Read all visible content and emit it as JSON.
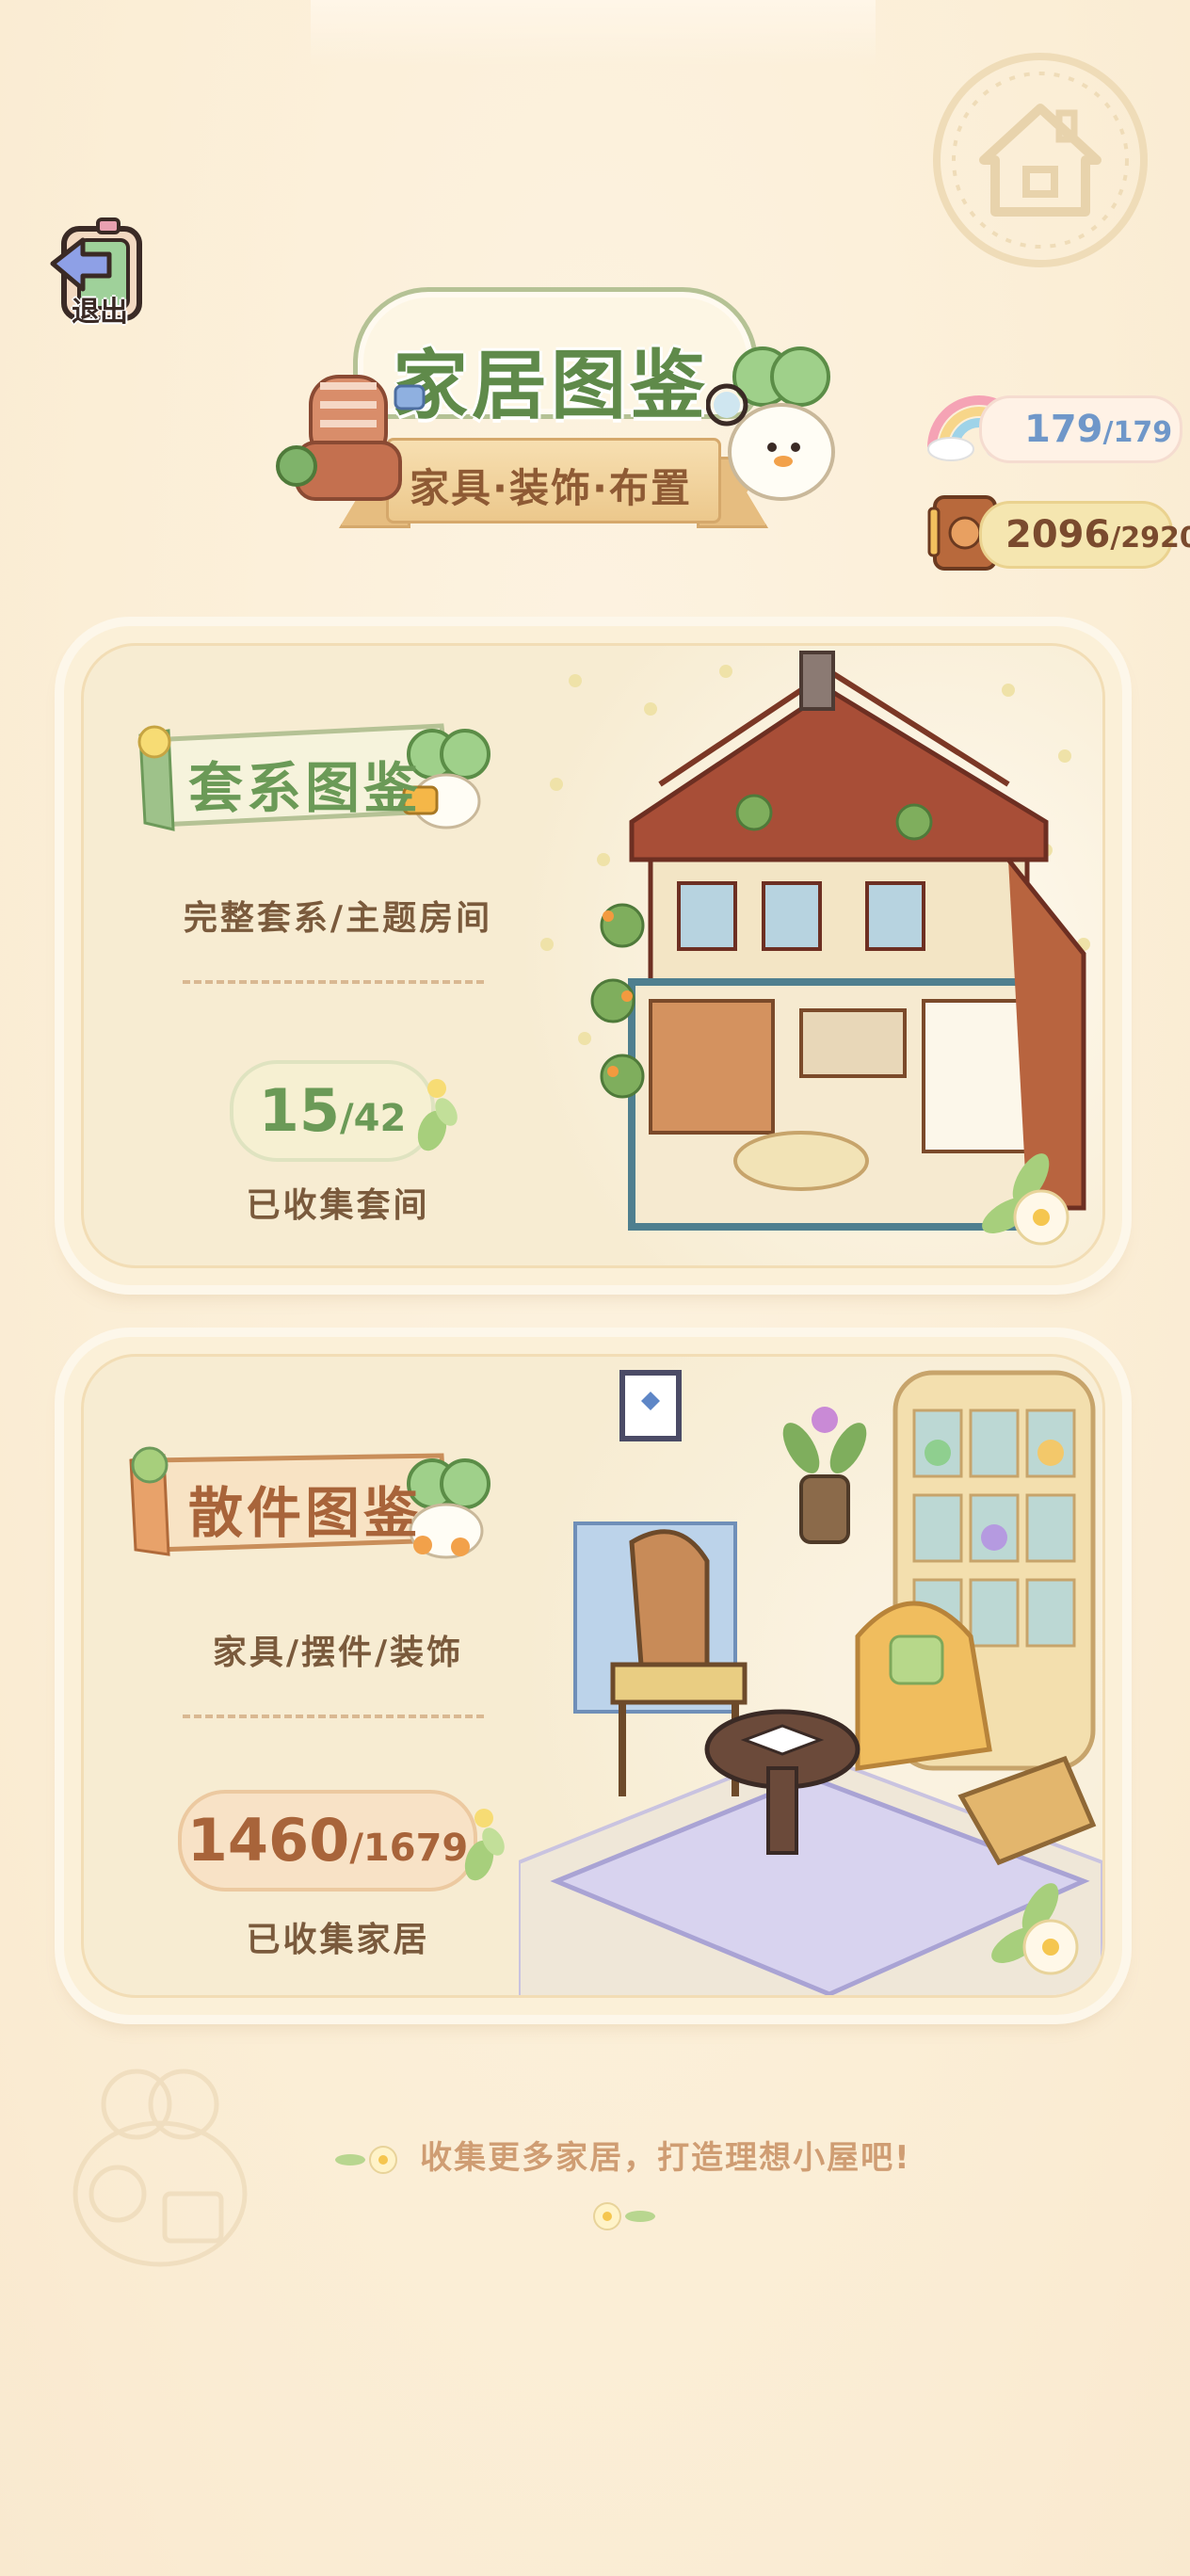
{
  "header": {
    "exit_label": "退出",
    "title": "家居图鉴",
    "subtitle": "家具·装饰·布置"
  },
  "currency": {
    "rainbow": {
      "current": "179",
      "max": "/179",
      "icon": "rainbow-icon"
    },
    "book": {
      "current": "2096",
      "max": "/2920",
      "icon": "book-icon"
    }
  },
  "cards": {
    "sets": {
      "tag": "套系图鉴",
      "description": "完整套系/主题房间",
      "count": "15",
      "total": "/42",
      "count_label": "已收集套间"
    },
    "items": {
      "tag": "散件图鉴",
      "description": "家具/摆件/装饰",
      "count": "1460",
      "total": "/1679",
      "count_label": "已收集家居"
    }
  },
  "footer": {
    "tip": "收集更多家居，打造理想小屋吧!"
  },
  "colors": {
    "background": "#fbeed6",
    "green_accent": "#5f8a4a",
    "brown_accent": "#a8643a",
    "blue_accent": "#6f97c9"
  }
}
